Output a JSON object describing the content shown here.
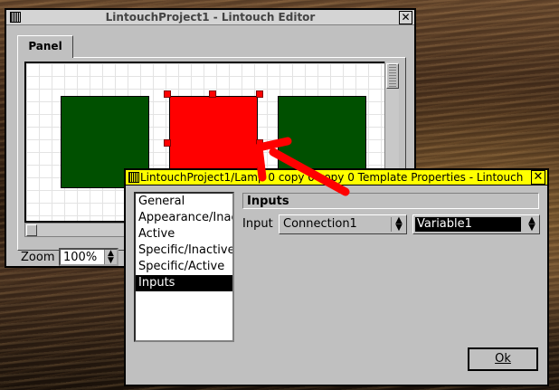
{
  "editor": {
    "title": "LintouchProject1 - Lintouch Editor",
    "close_glyph": "✕",
    "tab_label": "Panel",
    "zoom_label": "Zoom",
    "zoom_value": "100%"
  },
  "dialog": {
    "title": "LintouchProject1/Lamp 0 copy 0 copy 0 Template Properties - Lintouch",
    "close_glyph": "✕",
    "categories": [
      "General",
      "Appearance/Inactive",
      "Active",
      "Specific/Inactive",
      "Specific/Active",
      "Inputs"
    ],
    "selected_category": "Inputs",
    "section_title": "Inputs",
    "input_label": "Input",
    "connection_value": "Connection1",
    "variable_value": "Variable1",
    "ok_label": "Ok"
  },
  "colors": {
    "lamp_off": "#005000",
    "lamp_on": "#ff0000",
    "dialog_titlebar": "#ffff00",
    "annotation_arrow": "#ff0000"
  },
  "icons": {
    "spin": "up-down-arrows",
    "combo": "up-down-arrows"
  }
}
